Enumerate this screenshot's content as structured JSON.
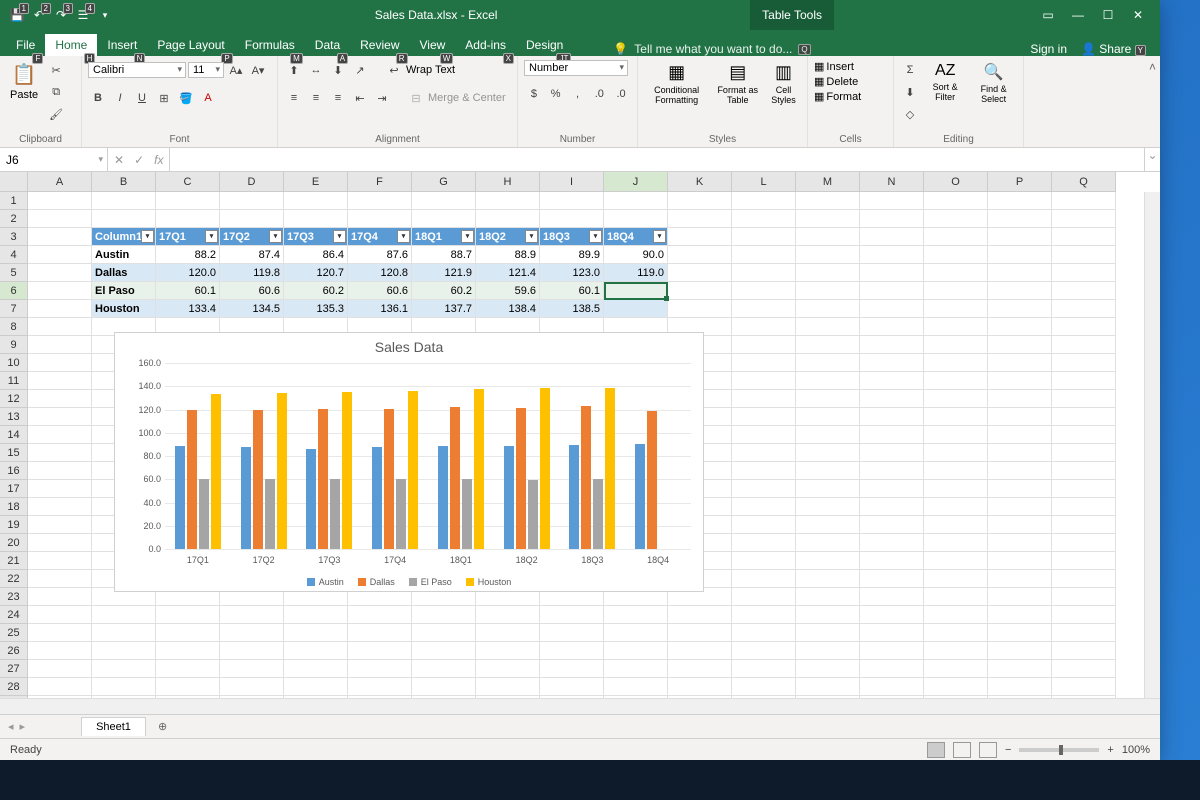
{
  "title": "Sales Data.xlsx - Excel",
  "tabletools_label": "Table Tools",
  "qat_badges": [
    "1",
    "2",
    "3",
    "4"
  ],
  "win_controls": [
    "ribbon-opts",
    "minimize",
    "maximize",
    "close"
  ],
  "tabs": [
    {
      "label": "File",
      "key": "F"
    },
    {
      "label": "Home",
      "key": "H",
      "active": true
    },
    {
      "label": "Insert",
      "key": "N"
    },
    {
      "label": "Page Layout",
      "key": "P"
    },
    {
      "label": "Formulas",
      "key": "M"
    },
    {
      "label": "Data",
      "key": "A"
    },
    {
      "label": "Review",
      "key": "R"
    },
    {
      "label": "View",
      "key": "W"
    },
    {
      "label": "Add-ins",
      "key": "X"
    },
    {
      "label": "Design",
      "key": "JT"
    }
  ],
  "tellme_hint": "Tell me what you want to do...",
  "tellme_key": "Q",
  "signin": "Sign in",
  "share": "Share",
  "share_key": "Y",
  "ribbon": {
    "clipboard": {
      "label": "Clipboard",
      "paste": "Paste"
    },
    "font": {
      "label": "Font",
      "family": "Calibri",
      "size": "11",
      "bold": "B",
      "italic": "I",
      "underline": "U"
    },
    "alignment": {
      "label": "Alignment",
      "wrap": "Wrap Text",
      "merge": "Merge & Center"
    },
    "number": {
      "label": "Number",
      "format": "Number"
    },
    "styles": {
      "label": "Styles",
      "cond": "Conditional Formatting",
      "fmttable": "Format as Table",
      "cellstyles": "Cell Styles"
    },
    "cells": {
      "label": "Cells",
      "insert": "Insert",
      "delete": "Delete",
      "format": "Format"
    },
    "editing": {
      "label": "Editing",
      "sort": "Sort & Filter",
      "find": "Find & Select"
    }
  },
  "namebox": "J6",
  "formula": "",
  "columns": [
    "A",
    "B",
    "C",
    "D",
    "E",
    "F",
    "G",
    "H",
    "I",
    "J",
    "K",
    "L",
    "M",
    "N",
    "O",
    "P",
    "Q"
  ],
  "selected_col": "J",
  "selected_row": 6,
  "table": {
    "start_col": 1,
    "headers": [
      "Column1",
      "17Q1",
      "17Q2",
      "17Q3",
      "17Q4",
      "18Q1",
      "18Q2",
      "18Q3",
      "18Q4"
    ],
    "rows": [
      {
        "label": "Austin",
        "vals": [
          "88.2",
          "87.4",
          "86.4",
          "87.6",
          "88.7",
          "88.9",
          "89.9",
          "90.0"
        ]
      },
      {
        "label": "Dallas",
        "vals": [
          "120.0",
          "119.8",
          "120.7",
          "120.8",
          "121.9",
          "121.4",
          "123.0",
          "119.0"
        ]
      },
      {
        "label": "El Paso",
        "vals": [
          "60.1",
          "60.6",
          "60.2",
          "60.6",
          "60.2",
          "59.6",
          "60.1",
          ""
        ]
      },
      {
        "label": "Houston",
        "vals": [
          "133.4",
          "134.5",
          "135.3",
          "136.1",
          "137.7",
          "138.4",
          "138.5",
          ""
        ]
      }
    ]
  },
  "chart_data": {
    "type": "bar",
    "title": "Sales Data",
    "categories": [
      "17Q1",
      "17Q2",
      "17Q3",
      "17Q4",
      "18Q1",
      "18Q2",
      "18Q3",
      "18Q4"
    ],
    "series": [
      {
        "name": "Austin",
        "color": "#5b9bd5",
        "values": [
          88.2,
          87.4,
          86.4,
          87.6,
          88.7,
          88.9,
          89.9,
          90.0
        ]
      },
      {
        "name": "Dallas",
        "color": "#ed7d31",
        "values": [
          120.0,
          119.8,
          120.7,
          120.8,
          121.9,
          121.4,
          123.0,
          119.0
        ]
      },
      {
        "name": "El Paso",
        "color": "#a5a5a5",
        "values": [
          60.1,
          60.6,
          60.2,
          60.6,
          60.2,
          59.6,
          60.1,
          null
        ]
      },
      {
        "name": "Houston",
        "color": "#ffc000",
        "values": [
          133.4,
          134.5,
          135.3,
          136.1,
          137.7,
          138.4,
          138.5,
          null
        ]
      }
    ],
    "ylim": [
      0,
      160
    ],
    "yticks": [
      0,
      20,
      40,
      60,
      80,
      100,
      120,
      140,
      160
    ],
    "xlabel": "",
    "ylabel": ""
  },
  "sheet_tab": "Sheet1",
  "status_left": "Ready",
  "zoom": "100%"
}
